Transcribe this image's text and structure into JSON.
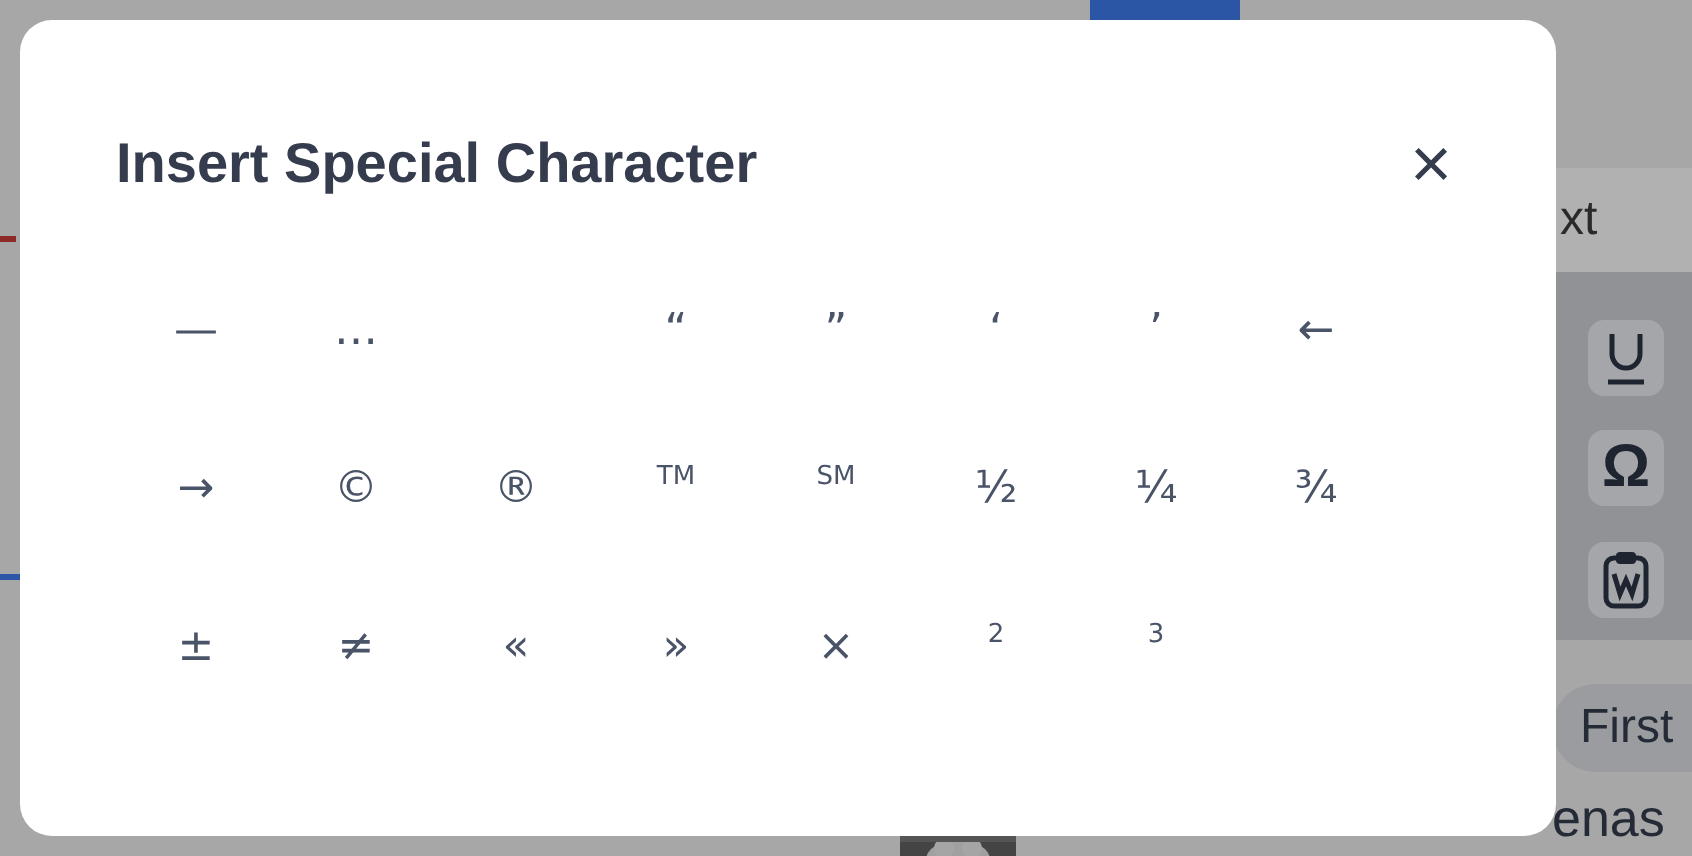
{
  "background": {
    "right_header": "xt",
    "toolbar": [
      {
        "kind": "underline"
      },
      {
        "kind": "text",
        "label": "Ω"
      },
      {
        "kind": "paste"
      }
    ],
    "first_button": "First",
    "right_text": "enas"
  },
  "dialog": {
    "title": "Insert Special Character",
    "close": "×",
    "characters": [
      {
        "kind": "char",
        "char": "—"
      },
      {
        "kind": "char",
        "char": "…"
      },
      {
        "kind": "blank"
      },
      {
        "kind": "char",
        "char": "“"
      },
      {
        "kind": "char",
        "char": "”"
      },
      {
        "kind": "char",
        "char": "‘"
      },
      {
        "kind": "char",
        "char": "’"
      },
      {
        "kind": "char",
        "char": "←"
      },
      {
        "kind": "char",
        "char": "→"
      },
      {
        "kind": "char",
        "char": "©"
      },
      {
        "kind": "char",
        "char": "®"
      },
      {
        "kind": "small",
        "char": "TM"
      },
      {
        "kind": "small",
        "char": "SM"
      },
      {
        "kind": "char",
        "char": "½"
      },
      {
        "kind": "char",
        "char": "¼"
      },
      {
        "kind": "char",
        "char": "¾"
      },
      {
        "kind": "char",
        "char": "±"
      },
      {
        "kind": "char",
        "char": "≠"
      },
      {
        "kind": "char",
        "char": "«"
      },
      {
        "kind": "char",
        "char": "»"
      },
      {
        "kind": "char",
        "char": "×"
      },
      {
        "kind": "small",
        "char": "2"
      },
      {
        "kind": "small",
        "char": "3"
      }
    ]
  }
}
